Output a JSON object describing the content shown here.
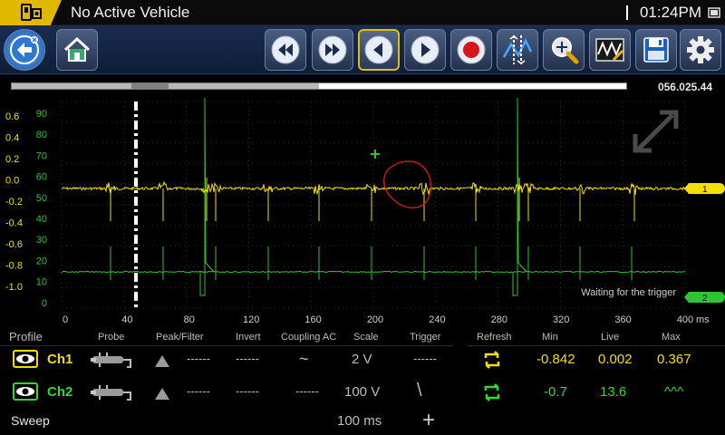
{
  "status_bar": {
    "vehicle": "No Active Vehicle",
    "time": "01:24PM"
  },
  "toolbar": {
    "buttons": [
      {
        "name": "back-button",
        "icon": "back-arrow-icon"
      },
      {
        "name": "home-button",
        "icon": "home-icon"
      },
      {
        "name": "rewind-button",
        "icon": "rewind-icon"
      },
      {
        "name": "fast-forward-button",
        "icon": "fast-forward-icon"
      },
      {
        "name": "step-back-button",
        "icon": "step-back-icon",
        "active": true
      },
      {
        "name": "step-forward-button",
        "icon": "step-forward-icon"
      },
      {
        "name": "record-button",
        "icon": "record-icon"
      },
      {
        "name": "cursors-button",
        "icon": "cursors-icon"
      },
      {
        "name": "zoom-button",
        "icon": "zoom-icon"
      },
      {
        "name": "scope-settings-button",
        "icon": "scope-settings-icon"
      },
      {
        "name": "save-button",
        "icon": "save-icon"
      },
      {
        "name": "settings-button",
        "icon": "gear-icon"
      }
    ]
  },
  "playback": {
    "timecode": "056.025.44",
    "buffer_fraction": 0.5,
    "window_start_fraction": 0.195,
    "window_end_fraction": 0.255
  },
  "graph": {
    "ch1_ticks": [
      "0.6",
      "0.4",
      "0.2",
      "0.0",
      "-0.2",
      "-0.4",
      "-0.6",
      "-0.8",
      "-1.0"
    ],
    "ch2_ticks": [
      "90",
      "80",
      "70",
      "60",
      "50",
      "40",
      "30",
      "20",
      "10",
      "0"
    ],
    "time_ticks": [
      "0",
      "40",
      "80",
      "120",
      "160",
      "200",
      "240",
      "280",
      "320",
      "360",
      "400"
    ],
    "time_unit": "ms",
    "waiting_text": "Waiting for the trigger",
    "ch1_marker": "1",
    "ch2_marker": "2",
    "colors": {
      "ch1": "#f4e000",
      "ch2": "#2fc52f"
    }
  },
  "panel": {
    "headers": {
      "profile": "Profile",
      "probe": "Probe",
      "peak_filter": "Peak/Filter",
      "invert": "Invert",
      "coupling": "Coupling AC",
      "scale": "Scale",
      "trigger": "Trigger",
      "refresh": "Refresh",
      "min": "Min",
      "live": "Live",
      "max": "Max"
    },
    "channels": [
      {
        "name": "Ch1",
        "filter": "------",
        "invert": "------",
        "coupling": "~",
        "scale": "2 V",
        "trigger": "------",
        "min": "-0.842",
        "live": "0.002",
        "max": "0.367"
      },
      {
        "name": "Ch2",
        "filter": "------",
        "invert": "------",
        "coupling": "------",
        "scale": "100 V",
        "trigger": "\\",
        "min": "-0.7",
        "live": "13.6",
        "max": "^^^"
      }
    ],
    "sweep_label": "Sweep",
    "sweep_value": "100 ms",
    "sweep_add": "+"
  }
}
